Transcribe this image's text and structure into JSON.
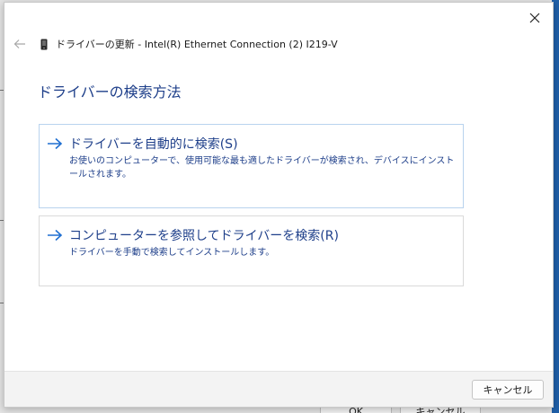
{
  "window": {
    "header_title": "ドライバーの更新 - Intel(R) Ethernet Connection (2) I219-V"
  },
  "page": {
    "title": "ドライバーの検索方法"
  },
  "options": [
    {
      "title": "ドライバーを自動的に検索(S)",
      "description": "お使いのコンピューターで、使用可能な最も適したドライバーが検索され、デバイスにインストールされます。"
    },
    {
      "title": "コンピューターを参照してドライバーを検索(R)",
      "description": "ドライバーを手動で検索してインストールします。"
    }
  ],
  "footer": {
    "cancel_label": "キャンセル"
  },
  "background": {
    "ok_label": "OK",
    "cancel_label": "キャンセル"
  },
  "colors": {
    "accent": "#1e3f8a",
    "link_arrow": "#1f6fd1"
  },
  "icons": {
    "close": "close-icon",
    "back": "back-arrow-icon",
    "device": "device-icon",
    "option_arrow": "arrow-right-icon"
  }
}
